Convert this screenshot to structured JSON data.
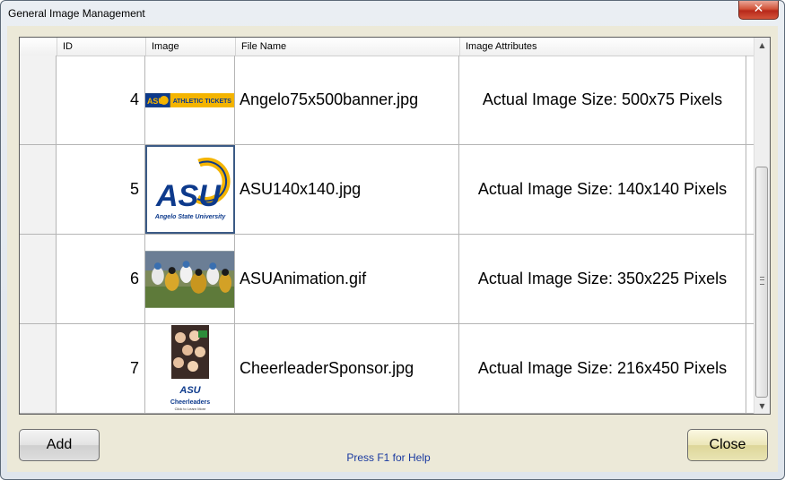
{
  "window": {
    "title": "General Image Management",
    "close_glyph": "✕"
  },
  "grid": {
    "columns": [
      "ID",
      "Image",
      "File Name",
      "Image Attributes"
    ],
    "rows": [
      {
        "id": "4",
        "image": "banner-thumbnail",
        "file_name": "Angelo75x500banner.jpg",
        "attributes": "Actual Image Size: 500x75 Pixels",
        "banner_text": "ATHLETIC TICKETS",
        "logo_text": "ASU"
      },
      {
        "id": "5",
        "image": "asu-logo-thumbnail",
        "file_name": "ASU140x140.jpg",
        "attributes": "Actual Image Size: 140x140 Pixels",
        "logo_text": "ASU",
        "logo_caption": "Angelo State University"
      },
      {
        "id": "6",
        "image": "football-photo-thumbnail",
        "file_name": "ASUAnimation.gif",
        "attributes": "Actual Image Size: 350x225 Pixels"
      },
      {
        "id": "7",
        "image": "cheerleader-sponsor-thumbnail",
        "file_name": "CheerleaderSponsor.jpg",
        "attributes": "Actual Image Size: 216x450 Pixels",
        "logo_text": "ASU",
        "caption": "Cheerleaders",
        "subcaption": "Click to Learn More"
      }
    ]
  },
  "buttons": {
    "add": "Add",
    "close": "Close"
  },
  "help_text": "Press F1 for Help",
  "colors": {
    "asu_blue": "#0d3a8c",
    "asu_gold": "#f4b400",
    "help_text": "#1a3aa0"
  }
}
